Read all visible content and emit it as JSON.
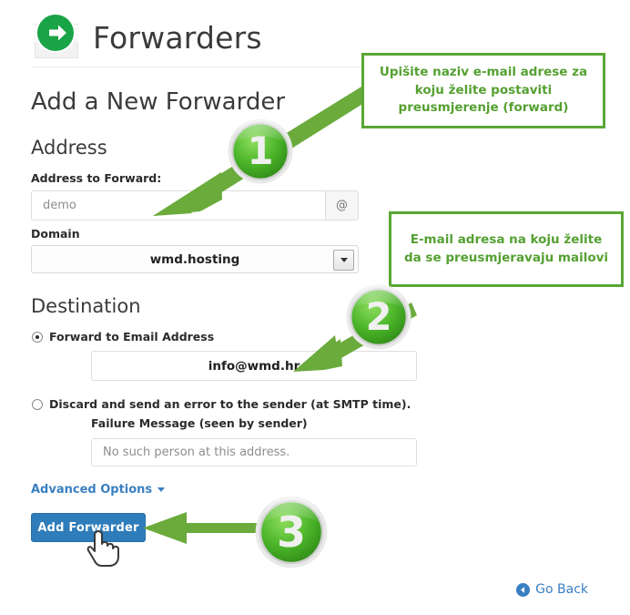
{
  "header": {
    "title": "Forwarders",
    "icon": "forwarder-envelope-icon"
  },
  "main": {
    "page_heading": "Add a New Forwarder",
    "address_section": {
      "heading": "Address",
      "address_label": "Address to Forward:",
      "address_value": "demo",
      "at_symbol": "@",
      "domain_label": "Domain",
      "domain_value": "wmd.hosting"
    },
    "destination_section": {
      "heading": "Destination",
      "forward_radio_label": "Forward to Email Address",
      "forward_email_value": "info@wmd.hr",
      "discard_radio_label": "Discard and send an error to the sender (at SMTP time).",
      "failure_label": "Failure Message (seen by sender)",
      "failure_value": "No such person at this address."
    },
    "advanced_options_label": "Advanced Options",
    "submit_label": "Add Forwarder",
    "go_back_label": "Go Back"
  },
  "annotations": {
    "callouts": [
      {
        "id": "callout-1",
        "lines": [
          "Upišite naziv e-mail adrese",
          "za koju želite postaviti",
          "preusmjerenje (forward)"
        ],
        "text": "Upišite naziv e-mail adrese za koju želite postaviti preusmjerenje (forward)"
      },
      {
        "id": "callout-2",
        "lines": [
          "E-mail adresa na koju želite",
          "da se preusmjeravaju",
          "mailovi"
        ],
        "text": "E-mail adresa na koju želite da se preusmjeravaju mailovi"
      }
    ],
    "badges": [
      {
        "id": "badge-1",
        "number": "1"
      },
      {
        "id": "badge-2",
        "number": "2"
      },
      {
        "id": "badge-3",
        "number": "3"
      }
    ]
  },
  "colors": {
    "annotation_green": "#5aa734",
    "arrow_green": "#6aab3c",
    "badge_green": "#4bb22a",
    "link_blue": "#3a7fc1",
    "button_blue": "#2e7cba",
    "logo_green": "#19a447"
  }
}
